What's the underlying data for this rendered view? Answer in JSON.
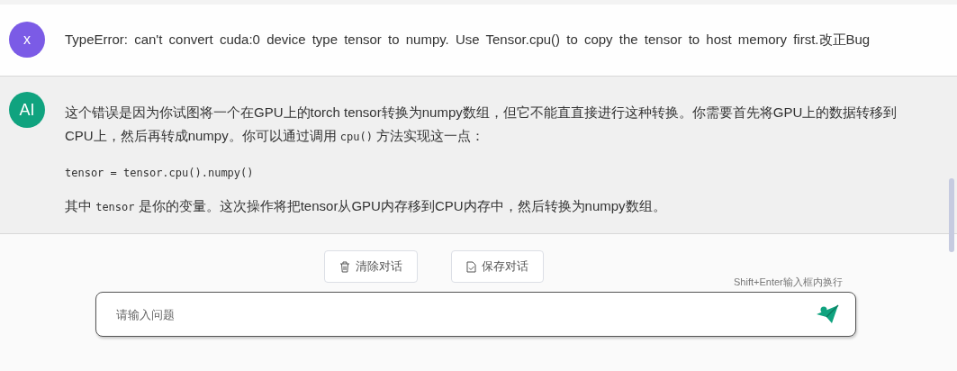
{
  "messages": [
    {
      "kind": "user",
      "avatar": "x",
      "color": "#7b5be6",
      "paragraphs": [
        {
          "kind": "text",
          "segments": [
            {
              "kind": "text",
              "text": "TypeError: can't convert cuda:0 device type tensor to numpy. Use Tensor.cpu() to copy the tensor to host memory first.改正Bug"
            }
          ]
        }
      ]
    },
    {
      "kind": "ai",
      "avatar": "AI",
      "color": "#10a37f",
      "paragraphs": [
        {
          "kind": "text",
          "segments": [
            {
              "kind": "text",
              "text": "这个错误是因为你试图将一个在GPU上的torch tensor转换为numpy数组，但它不能直直接进行这种转换。你需要首先将GPU上的数据转移到CPU上，然后再转成numpy。你可以通过调用 "
            },
            {
              "kind": "code",
              "text": "cpu()"
            },
            {
              "kind": "text",
              "text": " 方法实现这一点："
            }
          ]
        },
        {
          "kind": "code",
          "segments": [
            {
              "kind": "code",
              "text": "tensor = tensor.cpu().numpy()"
            }
          ]
        },
        {
          "kind": "text",
          "segments": [
            {
              "kind": "text",
              "text": "其中 "
            },
            {
              "kind": "code",
              "text": "tensor"
            },
            {
              "kind": "text",
              "text": " 是你的变量。这次操作将把tensor从GPU内存移到CPU内存中，然后转换为numpy数组。"
            }
          ]
        }
      ]
    }
  ],
  "actions": [
    {
      "kind": "clear",
      "label": "清除对话"
    },
    {
      "kind": "save",
      "label": "保存对话"
    }
  ],
  "hint": "Shift+Enter输入框内换行",
  "input": {
    "placeholder": "请输入问题"
  }
}
